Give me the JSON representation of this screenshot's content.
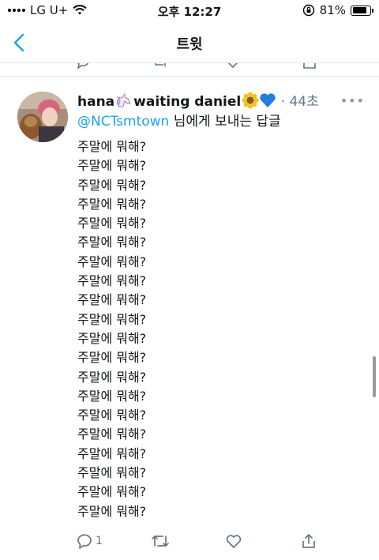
{
  "status_bar": {
    "carrier": "LG U+",
    "time": "오후 12:27",
    "battery": "81%",
    "battery_level": 0.81
  },
  "nav": {
    "title": "트윗"
  },
  "tweet": {
    "author_name": "hana",
    "author_name_rest": "waiting daniel",
    "emojis": [
      "unicorn",
      "sunflower",
      "blue-heart"
    ],
    "time_separator": " · ",
    "time_ago": "44초",
    "reply_handle": "@NCTsmtown",
    "reply_suffix": " 님에게 보내는 답글",
    "lines": [
      "주말에 뭐해?",
      "주말에 뭐해?",
      "주말에 뭐해?",
      "주말에 뭐해?",
      "주말에 뭐해?",
      "주말에 뭐해?",
      "주말에 뭐해?",
      "주말에 뭐해?",
      "주말에 뭐해?",
      "주말에 뭐해?",
      "주말에 뭐해?",
      "주말에 뭐해?",
      "주말에 뭐해?",
      "주말에 뭐해?",
      "주말에 뭐해?",
      "주말에 뭐해?",
      "주말에 뭐해?",
      "주말에 뭐해?",
      "주말에 뭐해?",
      "주말에 뭐해?"
    ],
    "reply_count": "1",
    "more_label": "•••"
  },
  "colors": {
    "accent": "#1da1f2",
    "secondary_text": "#657786"
  }
}
